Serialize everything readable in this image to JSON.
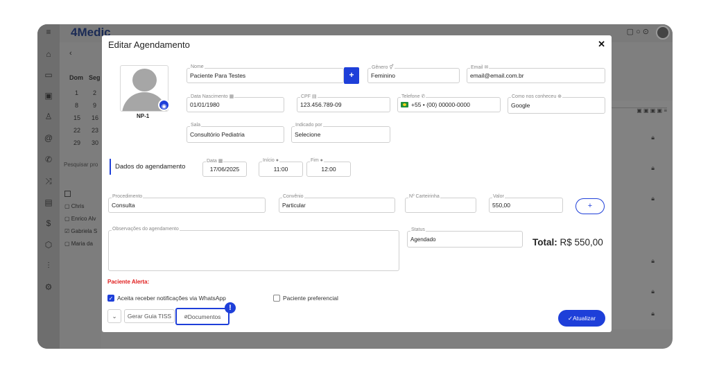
{
  "app": {
    "brand": "4Medic"
  },
  "background_calendar": {
    "day_headers": [
      "Dom",
      "Seg"
    ],
    "weeks": [
      [
        "1",
        "2"
      ],
      [
        "8",
        "9"
      ],
      [
        "15",
        "16"
      ],
      [
        "22",
        "23"
      ],
      [
        "29",
        "30"
      ]
    ],
    "search_placeholder": "Pesquisar pro",
    "people": [
      "Chris",
      "Enrico Alv",
      "Gabriela S",
      "Maria da"
    ]
  },
  "modal": {
    "title": "Editar Agendamento",
    "photo_caption": "NP-1",
    "fields": {
      "nome": {
        "label": "Nome",
        "value": "Paciente Para Testes"
      },
      "genero": {
        "label": "Gênero",
        "value": "Feminino"
      },
      "email": {
        "label": "Email",
        "value": "email@email.com.br"
      },
      "nascimento": {
        "label": "Data Nascimento",
        "value": "01/01/1980"
      },
      "cpf": {
        "label": "CPF",
        "value": "123.456.789-09"
      },
      "telefone": {
        "label": "Telefone",
        "value": "+55 •  (00) 00000-0000"
      },
      "conheceu": {
        "label": "Como nos conheceu",
        "value": "Google"
      },
      "sala": {
        "label": "Sala",
        "value": "Consultório Pediatria"
      },
      "indicado": {
        "label": "Indicado por",
        "value": "Selecione"
      },
      "data": {
        "label": "Data",
        "value": "17/06/2025"
      },
      "inicio": {
        "label": "Início",
        "value": "11:00"
      },
      "fim": {
        "label": "Fim",
        "value": "12:00"
      },
      "procedimento": {
        "label": "Procedimento",
        "value": "Consulta"
      },
      "convenio": {
        "label": "Convênio",
        "value": "Particular"
      },
      "carteirinha": {
        "label": "Nº Carteirinha",
        "value": ""
      },
      "valor": {
        "label": "Valor",
        "value": "550,00"
      },
      "observacoes": {
        "label": "Observações do agendamento",
        "value": ""
      },
      "status": {
        "label": "Status",
        "value": "Agendado"
      }
    },
    "section_label": "Dados do agendamento",
    "total_label": "Total:",
    "total_value": "R$ 550,00",
    "alert_label": "Paciente Alerta:",
    "whatsapp_label": "Aceita receber notificações via WhatsApp",
    "preferencial_label": "Paciente preferencial",
    "gerar_guia_label": "Gerar Guia TISS",
    "documentos_label": "Documentos",
    "atualizar_label": "Atualizar",
    "badge": "!"
  },
  "colors": {
    "primary": "#1e3fd9",
    "alert": "#e01b1b"
  },
  "icons": [
    "home-icon",
    "calendar-icon",
    "wallet-icon",
    "user-icon",
    "at-icon",
    "phone-icon",
    "shuffle-icon",
    "list-icon",
    "dollar-icon",
    "box-icon",
    "chart-icon",
    "gear-icon",
    "camera-icon",
    "gender-icon",
    "mail-icon",
    "cpf-icon",
    "phone-small-icon",
    "globe-icon",
    "clock-icon",
    "chevron-down-icon",
    "paperclip-icon",
    "check-icon",
    "close-icon",
    "lock-icon"
  ]
}
